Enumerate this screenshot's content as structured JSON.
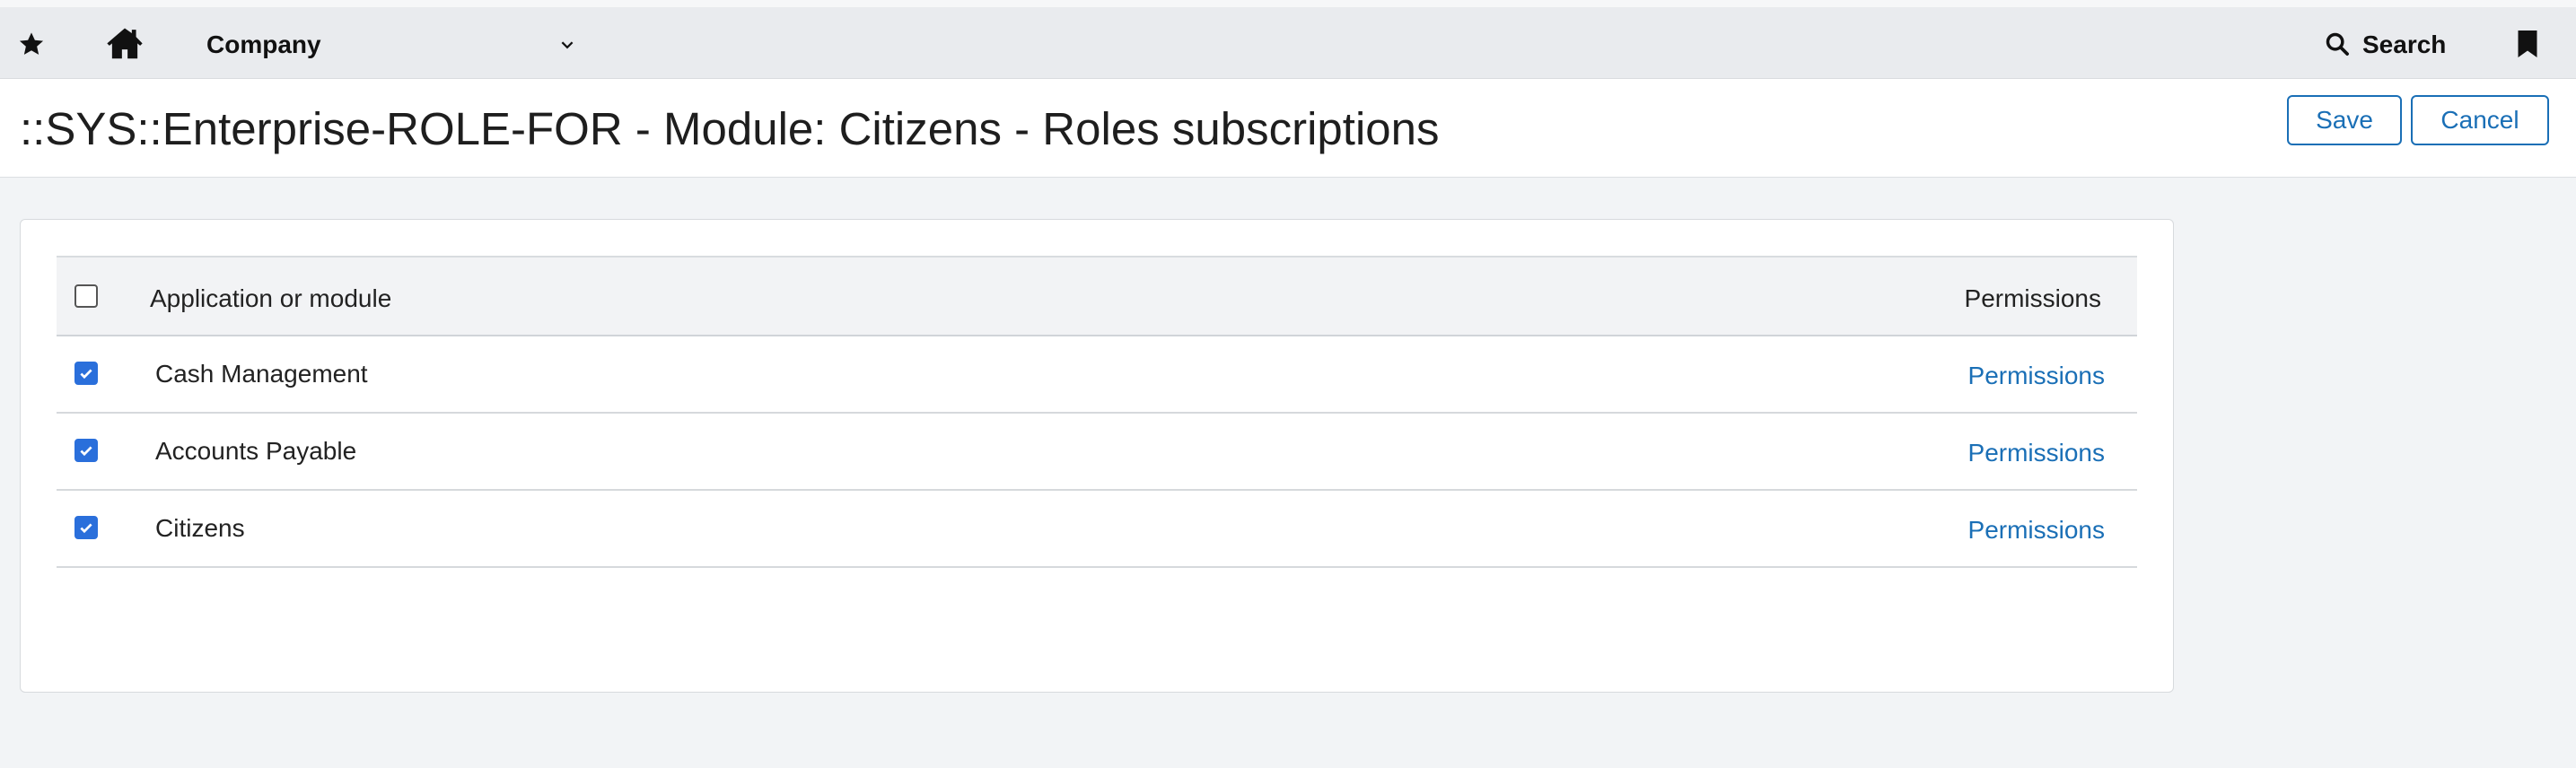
{
  "topbar": {
    "company_label": "Company",
    "search_label": "Search"
  },
  "page": {
    "title": "::SYS::Enterprise-ROLE-FOR - Module: Citizens - Roles subscriptions",
    "save_label": "Save",
    "cancel_label": "Cancel"
  },
  "table": {
    "header_module": "Application or module",
    "header_permissions": "Permissions",
    "rows": [
      {
        "module": "Cash Management",
        "permissions": "Permissions",
        "checked": true
      },
      {
        "module": "Accounts Payable",
        "permissions": "Permissions",
        "checked": true
      },
      {
        "module": "Citizens",
        "permissions": "Permissions",
        "checked": true
      }
    ]
  },
  "colors": {
    "accent": "#1a6fb6",
    "checkbox": "#2a6fdb",
    "topbar_bg": "#e9ebee",
    "page_bg": "#f2f4f6"
  }
}
